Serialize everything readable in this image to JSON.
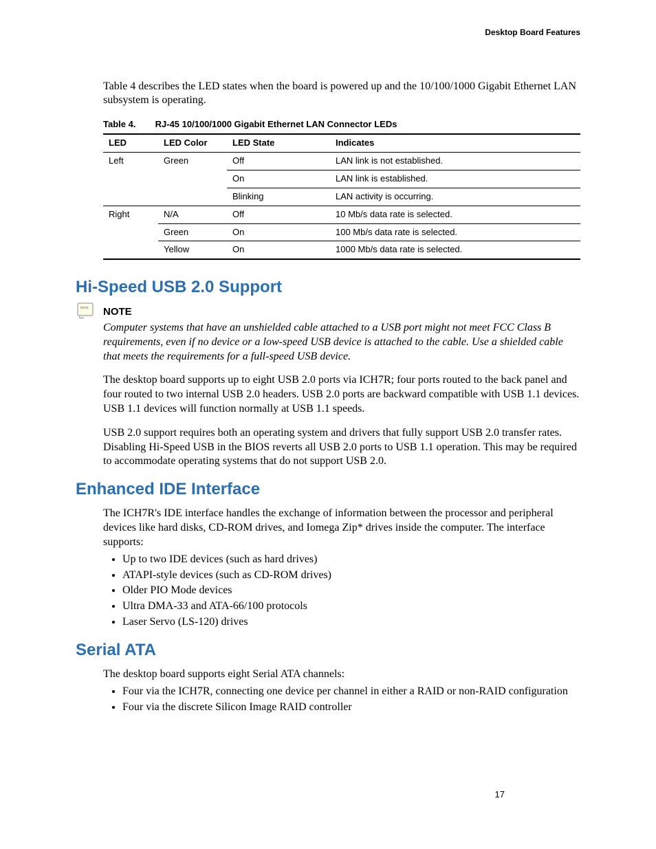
{
  "header": "Desktop Board Features",
  "intro": "Table 4 describes the LED states when the board is powered up and the 10/100/1000 Gigabit Ethernet LAN subsystem is operating.",
  "table": {
    "number": "Table 4.",
    "title": "RJ-45 10/100/1000 Gigabit Ethernet LAN Connector LEDs",
    "headers": [
      "LED",
      "LED Color",
      "LED State",
      "Indicates"
    ],
    "rows": [
      {
        "led": "Left",
        "color": "Green",
        "state": "Off",
        "ind": "LAN link is not established."
      },
      {
        "led": "",
        "color": "",
        "state": "On",
        "ind": "LAN link is established."
      },
      {
        "led": "",
        "color": "",
        "state": "Blinking",
        "ind": "LAN activity is occurring."
      },
      {
        "led": "Right",
        "color": "N/A",
        "state": "Off",
        "ind": "10 Mb/s data rate is selected."
      },
      {
        "led": "",
        "color": "Green",
        "state": "On",
        "ind": "100 Mb/s data rate is selected."
      },
      {
        "led": "",
        "color": "Yellow",
        "state": "On",
        "ind": "1000 Mb/s data rate is selected."
      }
    ]
  },
  "sections": {
    "usb": {
      "heading": "Hi-Speed USB 2.0 Support",
      "note_label": "NOTE",
      "note_text": "Computer systems that have an unshielded cable attached to a USB port might not meet FCC Class B requirements, even if no device or a low-speed USB device is attached to the cable. Use a shielded cable that meets the requirements for a full-speed USB device.",
      "para1": "The desktop board supports up to eight USB 2.0 ports via ICH7R; four ports routed to the back panel and four routed to two internal USB 2.0 headers.  USB 2.0 ports are backward compatible with USB 1.1 devices.  USB 1.1 devices will function normally at USB 1.1 speeds.",
      "para2": "USB 2.0 support requires both an operating system and drivers that fully support USB 2.0 transfer rates.  Disabling Hi-Speed USB in the BIOS reverts all USB 2.0 ports to USB 1.1 operation.  This may be required to accommodate operating systems that do not support USB 2.0."
    },
    "ide": {
      "heading": "Enhanced IDE Interface",
      "para": "The ICH7R's IDE interface handles the exchange of information between the processor and peripheral devices like hard disks, CD-ROM drives, and Iomega Zip* drives inside the computer. The interface supports:",
      "bullets": [
        "Up to two IDE devices (such as hard drives)",
        "ATAPI-style devices (such as CD-ROM drives)",
        "Older PIO Mode devices",
        "Ultra DMA-33 and ATA-66/100 protocols",
        "Laser Servo (LS-120) drives"
      ]
    },
    "sata": {
      "heading": "Serial ATA",
      "para": "The desktop board supports eight Serial ATA channels:",
      "bullets": [
        "Four via the ICH7R, connecting one device per channel in either a RAID or non-RAID configuration",
        "Four via the discrete Silicon Image RAID controller"
      ]
    }
  },
  "page_number": "17"
}
